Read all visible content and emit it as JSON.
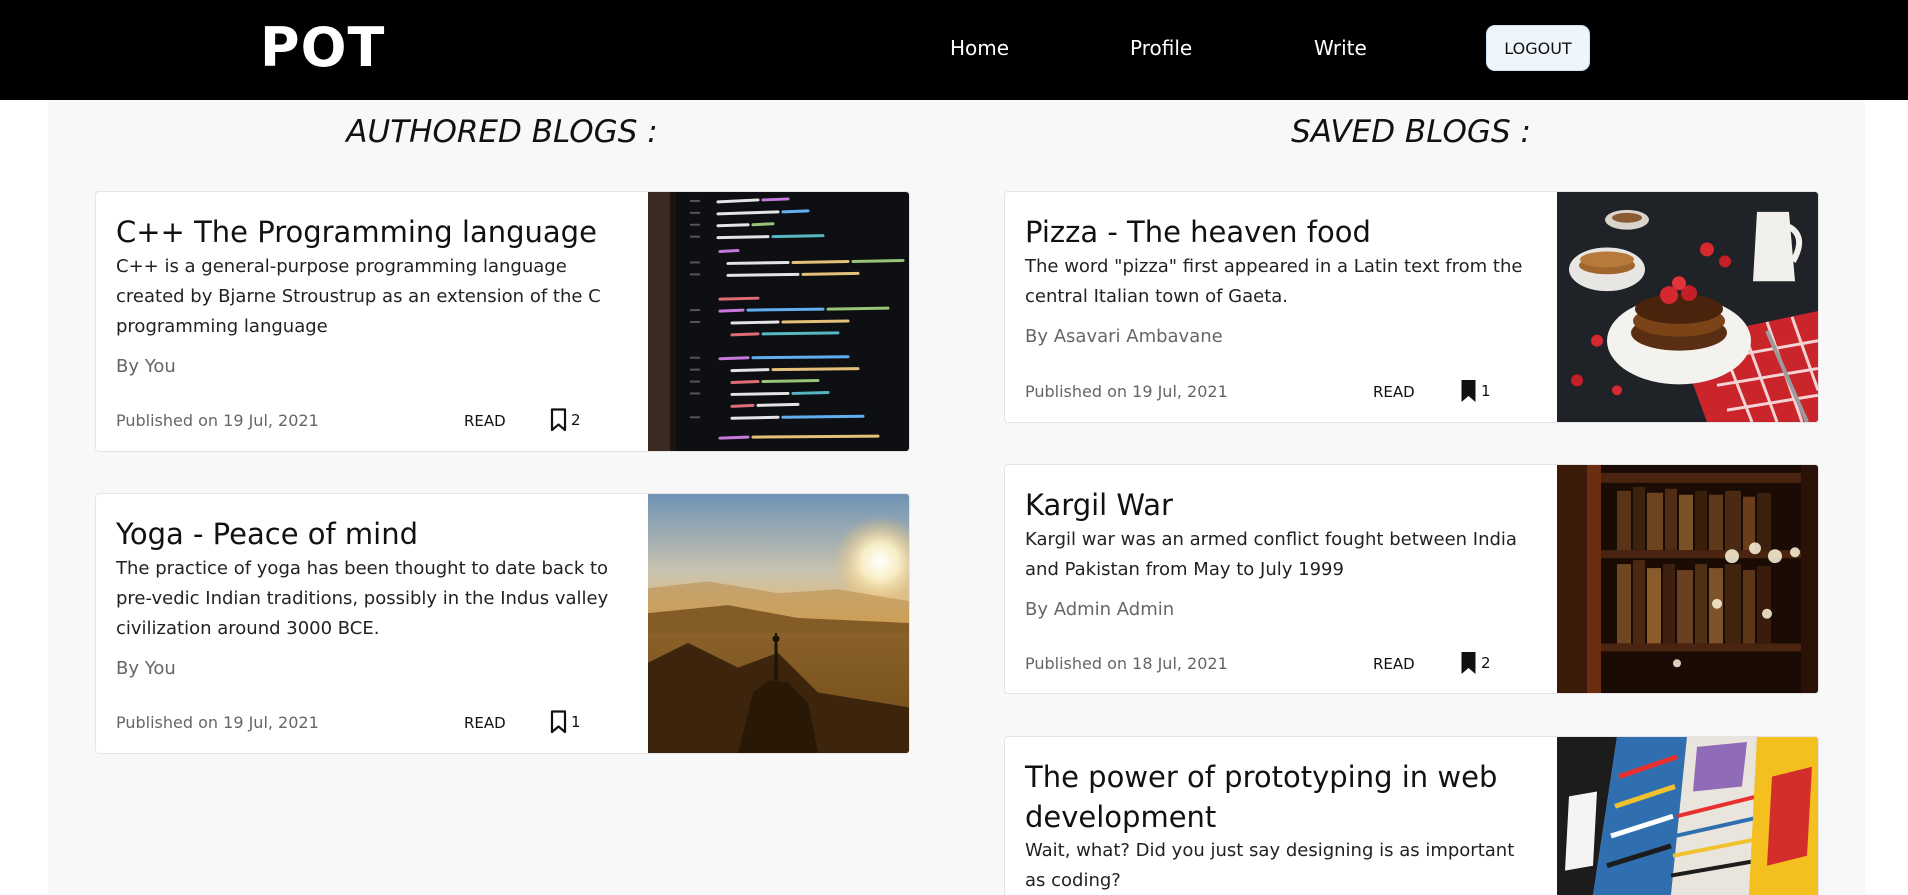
{
  "nav": {
    "logo": "POT",
    "links": [
      "Home",
      "Profile",
      "Write"
    ],
    "logout": "LOGOUT"
  },
  "authored": {
    "heading": "AUTHORED BLOGS :",
    "cards": [
      {
        "title": "C++ The Programming language",
        "desc": "C++ is a general-purpose programming language created by Bjarne Stroustrup as an extension of the C programming language",
        "author": "By You",
        "date": "Published on 19 Jul, 2021",
        "read": "READ",
        "bookmarks": "2",
        "bookmark_icon": "bookmark-outline-icon",
        "image": "code-screen-photo"
      },
      {
        "title": "Yoga - Peace of mind",
        "desc": "The practice of yoga has been thought to date back to pre-vedic Indian traditions, possibly in the Indus valley civilization around 3000 BCE.",
        "author": "By You",
        "date": "Published on 19 Jul, 2021",
        "read": "READ",
        "bookmarks": "1",
        "bookmark_icon": "bookmark-outline-icon",
        "image": "yoga-sunset-photo"
      }
    ]
  },
  "saved": {
    "heading": "SAVED BLOGS :",
    "cards": [
      {
        "title": "Pizza - The heaven food",
        "desc": "The word \"pizza\" first appeared in a Latin text from the central Italian town of Gaeta.",
        "author": "By Asavari Ambavane",
        "date": "Published on 19 Jul, 2021",
        "read": "READ",
        "bookmarks": "1",
        "bookmark_icon": "bookmark-filled-icon",
        "image": "pancakes-photo"
      },
      {
        "title": "Kargil War",
        "desc": "Kargil war was an armed conflict fought between India and Pakistan from May to July 1999",
        "author": "By Admin Admin",
        "date": "Published on 18 Jul, 2021",
        "read": "READ",
        "bookmarks": "2",
        "bookmark_icon": "bookmark-filled-icon",
        "image": "bookshelf-photo"
      },
      {
        "title": "The power of prototyping in web development",
        "desc": "Wait, what? Did you just say designing is as important as coding?",
        "image": "colorful-posters-photo"
      }
    ]
  },
  "colors": {
    "navbar": "#000000",
    "logout_bg": "#eef5fb",
    "main_bg": "#f8f8f8"
  }
}
